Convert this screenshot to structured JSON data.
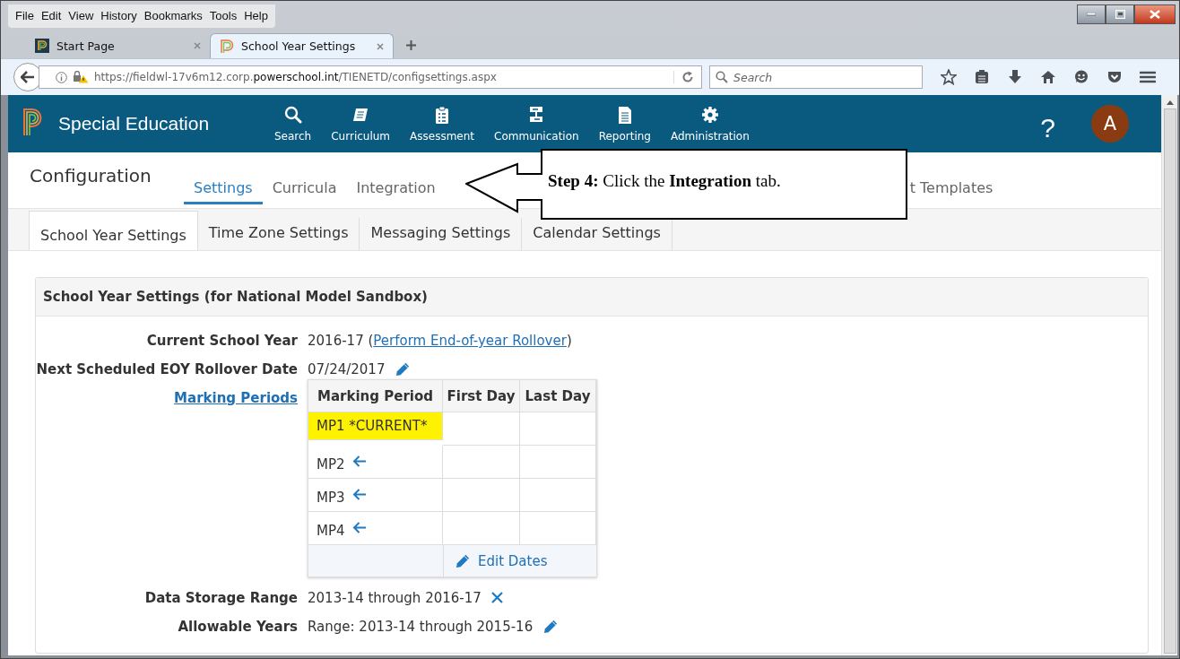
{
  "browser": {
    "menu": [
      "File",
      "Edit",
      "View",
      "History",
      "Bookmarks",
      "Tools",
      "Help"
    ],
    "tabs": [
      {
        "title": "Start Page",
        "selected": false
      },
      {
        "title": "School Year Settings",
        "selected": true
      }
    ],
    "url": {
      "prefix": "https://fieldwl-17v6m12.corp.",
      "domain": "powerschool.int",
      "path": "/TIENETD/configsettings.aspx"
    },
    "search": {
      "placeholder": "Search"
    }
  },
  "app": {
    "title": "Special Education",
    "nav": [
      {
        "label": "Search"
      },
      {
        "label": "Curriculum"
      },
      {
        "label": "Assessment"
      },
      {
        "label": "Communication"
      },
      {
        "label": "Reporting"
      },
      {
        "label": "Administration"
      }
    ],
    "help": "?",
    "avatar": "A"
  },
  "page": {
    "title": "Configuration",
    "tabs": [
      {
        "label": "Settings",
        "selected": true
      },
      {
        "label": "Curricula",
        "selected": false
      },
      {
        "label": "Integration",
        "selected": false
      },
      {
        "label": "t Templates",
        "selected": false
      }
    ],
    "subtabs": [
      {
        "label": "School Year Settings",
        "selected": true
      },
      {
        "label": "Time Zone Settings",
        "selected": false
      },
      {
        "label": "Messaging Settings",
        "selected": false
      },
      {
        "label": "Calendar Settings",
        "selected": false
      }
    ],
    "panel": {
      "title": "School Year Settings (for National Model Sandbox)",
      "fields": [
        {
          "kind": "linked",
          "label": "Current School Year",
          "value": "2016-17 (",
          "link": "Perform End-of-year Rollover",
          "suffix": ")"
        },
        {
          "kind": "value",
          "label": "Next Scheduled EOY Rollover Date",
          "value": "07/24/2017",
          "editable": true
        },
        {
          "kind": "table",
          "label": "Marking Periods",
          "columns": [
            "Marking Period",
            "First Day",
            "Last Day"
          ],
          "rows": [
            {
              "period": "MP1 *CURRENT*",
              "current": true
            },
            {
              "period": "MP2",
              "current": false
            },
            {
              "period": "MP3",
              "current": false
            },
            {
              "period": "MP4",
              "current": false
            }
          ],
          "footer": "Edit Dates"
        },
        {
          "kind": "value",
          "label": "Data Storage Range",
          "value": "2013-14 through 2016-17",
          "removable": true
        },
        {
          "kind": "value",
          "label": "Allowable Years",
          "value": "Range: 2013-14 through 2015-16",
          "editable": true
        }
      ]
    }
  },
  "callout": {
    "text": "**Step 4:** Click the **Integration** tab."
  }
}
